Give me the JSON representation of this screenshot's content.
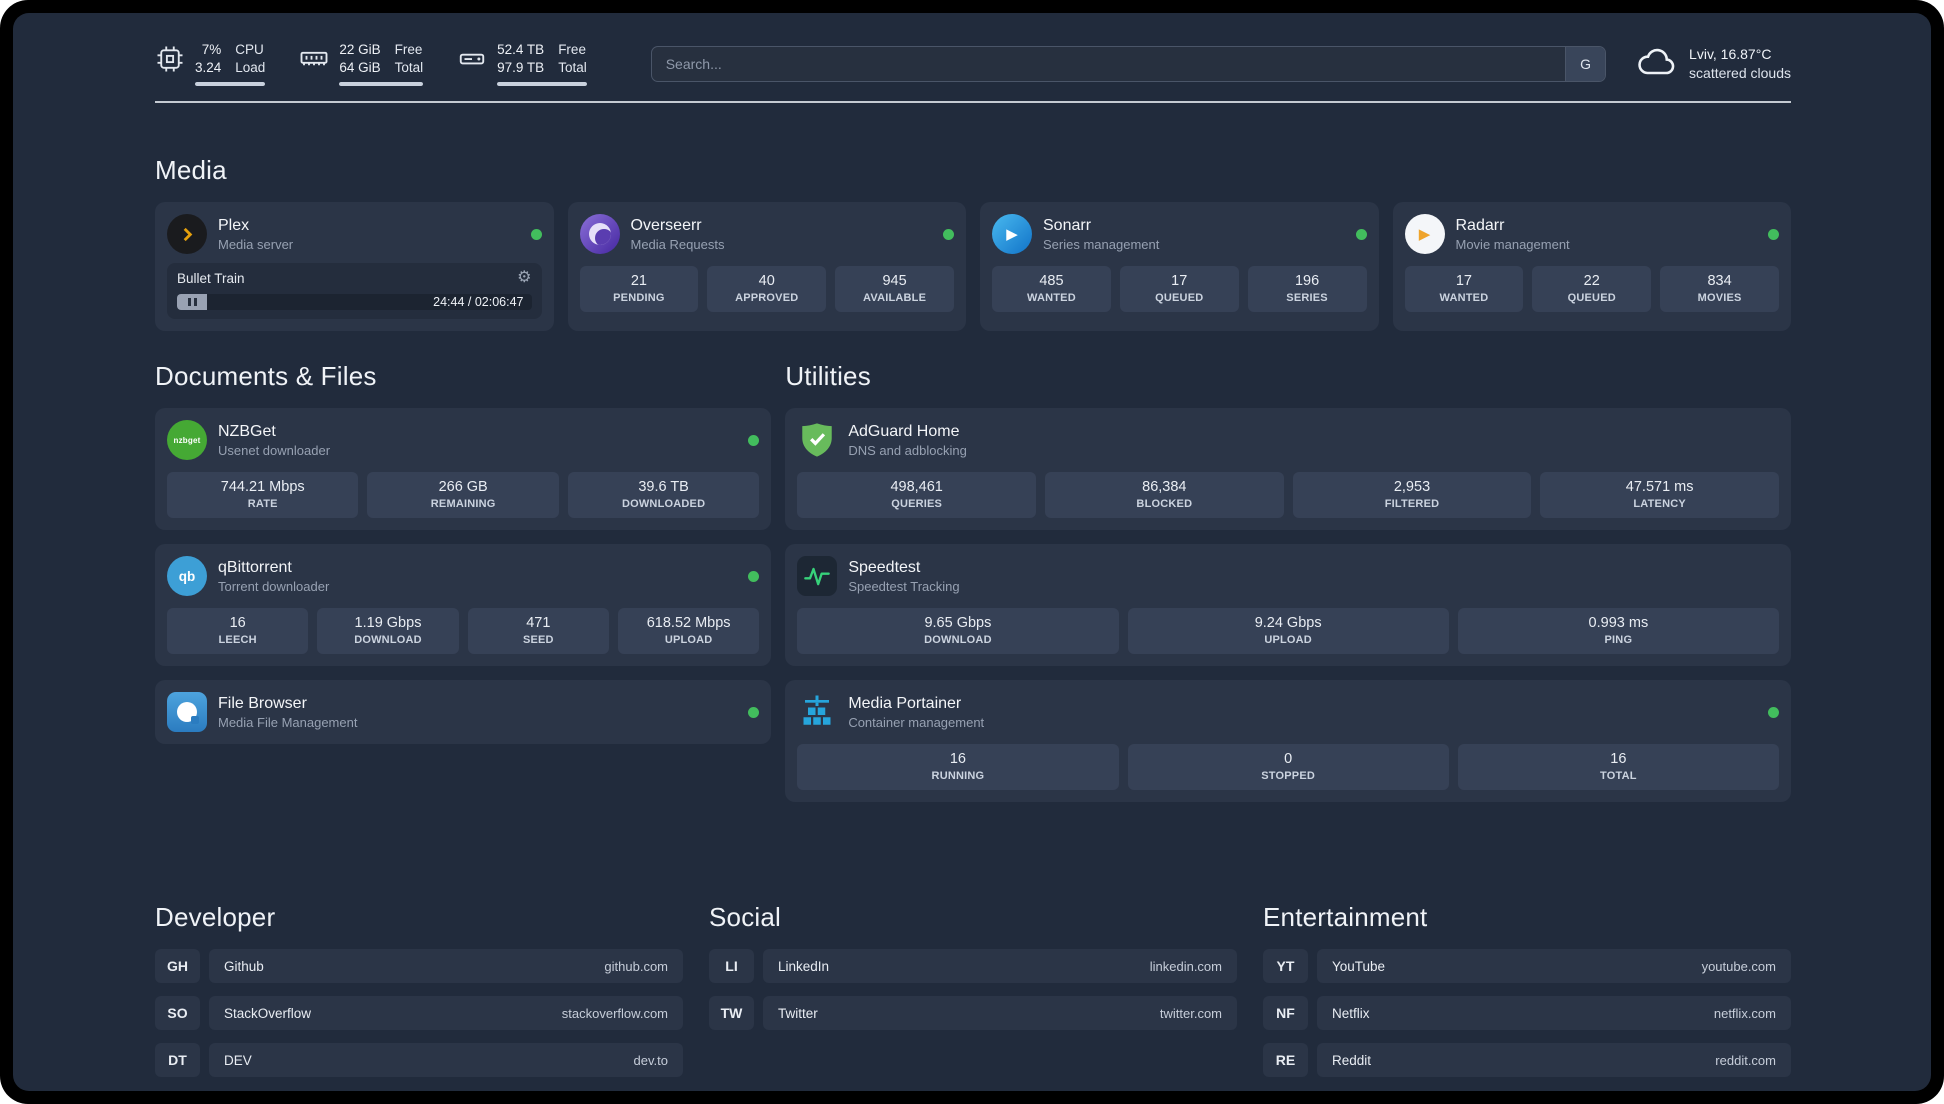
{
  "topbar": {
    "cpu": {
      "value1": "7%",
      "value2": "3.24",
      "label1": "CPU",
      "label2": "Load"
    },
    "ram": {
      "value1": "22 GiB",
      "value2": "64 GiB",
      "label1": "Free",
      "label2": "Total"
    },
    "disk": {
      "value1": "52.4 TB",
      "value2": "97.9 TB",
      "label1": "Free",
      "label2": "Total"
    },
    "search": {
      "placeholder": "Search...",
      "engine_badge": "G"
    },
    "weather": {
      "location": "Lviv, 16.87°C",
      "condition": "scattered clouds"
    }
  },
  "sections": {
    "media": {
      "title": "Media",
      "apps": [
        {
          "name": "Plex",
          "subtitle": "Media server",
          "online": true,
          "player": {
            "track": "Bullet Train",
            "time": "24:44 / 02:06:47"
          }
        },
        {
          "name": "Overseerr",
          "subtitle": "Media Requests",
          "online": true,
          "stats": [
            {
              "value": "21",
              "label": "PENDING"
            },
            {
              "value": "40",
              "label": "APPROVED"
            },
            {
              "value": "945",
              "label": "AVAILABLE"
            }
          ]
        },
        {
          "name": "Sonarr",
          "subtitle": "Series management",
          "online": true,
          "stats": [
            {
              "value": "485",
              "label": "WANTED"
            },
            {
              "value": "17",
              "label": "QUEUED"
            },
            {
              "value": "196",
              "label": "SERIES"
            }
          ]
        },
        {
          "name": "Radarr",
          "subtitle": "Movie management",
          "online": true,
          "stats": [
            {
              "value": "17",
              "label": "WANTED"
            },
            {
              "value": "22",
              "label": "QUEUED"
            },
            {
              "value": "834",
              "label": "MOVIES"
            }
          ]
        }
      ]
    },
    "documents": {
      "title": "Documents & Files",
      "apps": [
        {
          "name": "NZBGet",
          "subtitle": "Usenet downloader",
          "online": true,
          "stats": [
            {
              "value": "744.21 Mbps",
              "label": "RATE"
            },
            {
              "value": "266 GB",
              "label": "REMAINING"
            },
            {
              "value": "39.6 TB",
              "label": "DOWNLOADED"
            }
          ]
        },
        {
          "name": "qBittorrent",
          "subtitle": "Torrent downloader",
          "online": true,
          "stats": [
            {
              "value": "16",
              "label": "LEECH"
            },
            {
              "value": "1.19 Gbps",
              "label": "DOWNLOAD"
            },
            {
              "value": "471",
              "label": "SEED"
            },
            {
              "value": "618.52 Mbps",
              "label": "UPLOAD"
            }
          ]
        },
        {
          "name": "File Browser",
          "subtitle": "Media File Management",
          "online": true,
          "stats": []
        }
      ]
    },
    "utilities": {
      "title": "Utilities",
      "apps": [
        {
          "name": "AdGuard Home",
          "subtitle": "DNS and adblocking",
          "online": false,
          "stats": [
            {
              "value": "498,461",
              "label": "QUERIES"
            },
            {
              "value": "86,384",
              "label": "BLOCKED"
            },
            {
              "value": "2,953",
              "label": "FILTERED"
            },
            {
              "value": "47.571 ms",
              "label": "LATENCY"
            }
          ]
        },
        {
          "name": "Speedtest",
          "subtitle": "Speedtest Tracking",
          "online": false,
          "stats": [
            {
              "value": "9.65 Gbps",
              "label": "DOWNLOAD"
            },
            {
              "value": "9.24 Gbps",
              "label": "UPLOAD"
            },
            {
              "value": "0.993 ms",
              "label": "PING"
            }
          ]
        },
        {
          "name": "Media Portainer",
          "subtitle": "Container management",
          "online": true,
          "stats": [
            {
              "value": "16",
              "label": "RUNNING"
            },
            {
              "value": "0",
              "label": "STOPPED"
            },
            {
              "value": "16",
              "label": "TOTAL"
            }
          ]
        }
      ]
    },
    "developer": {
      "title": "Developer",
      "links": [
        {
          "abbr": "GH",
          "name": "Github",
          "domain": "github.com"
        },
        {
          "abbr": "SO",
          "name": "StackOverflow",
          "domain": "stackoverflow.com"
        },
        {
          "abbr": "DT",
          "name": "DEV",
          "domain": "dev.to"
        }
      ]
    },
    "social": {
      "title": "Social",
      "links": [
        {
          "abbr": "LI",
          "name": "LinkedIn",
          "domain": "linkedin.com"
        },
        {
          "abbr": "TW",
          "name": "Twitter",
          "domain": "twitter.com"
        }
      ]
    },
    "entertainment": {
      "title": "Entertainment",
      "links": [
        {
          "abbr": "YT",
          "name": "YouTube",
          "domain": "youtube.com"
        },
        {
          "abbr": "NF",
          "name": "Netflix",
          "domain": "netflix.com"
        },
        {
          "abbr": "RE",
          "name": "Reddit",
          "domain": "reddit.com"
        }
      ]
    }
  },
  "icon_text": {
    "nzbget": "nzbget",
    "qbittorrent": "qb",
    "play_arrow": "▶",
    "gear": "⚙"
  },
  "colors": {
    "background": "#212b3c",
    "card": "#2b3547",
    "tile": "#364156",
    "status_online": "#42bd5d",
    "plex_amber": "#e5a00d",
    "divider": "#d3d8e0"
  }
}
